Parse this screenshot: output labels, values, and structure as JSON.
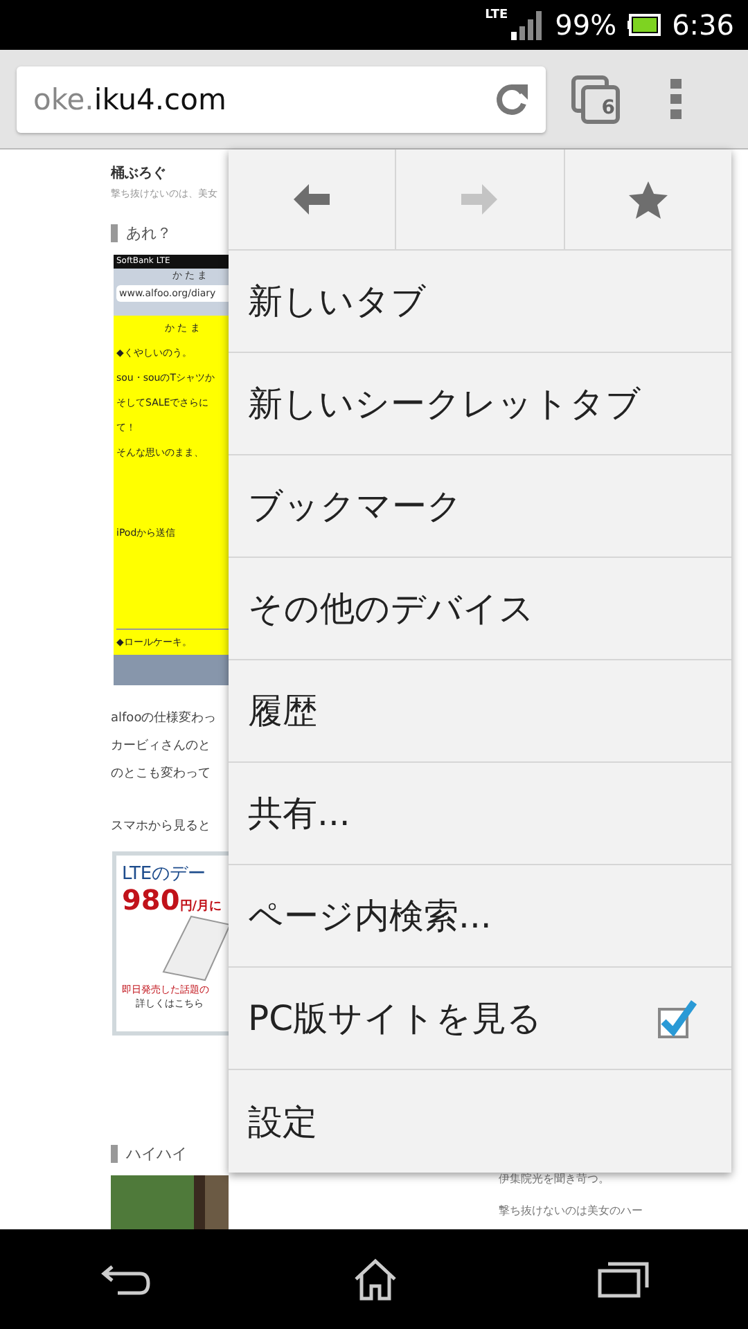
{
  "status_bar": {
    "network": "LTE",
    "battery": "99%",
    "time": "6:36"
  },
  "toolbar": {
    "url_host_prefix": "oke.",
    "url_domain": "iku4.com",
    "tab_count": "6"
  },
  "page": {
    "blog_title": "桶ぶろぐ",
    "blog_subtitle": "撃ち抜けないのは、美女",
    "post_title": "あれ？",
    "shot": {
      "carrier": "SoftBank  LTE",
      "header": "か た ま",
      "url": "www.alfoo.org/diary",
      "lines": [
        {
          "kind": "center",
          "text": "か た ま"
        },
        {
          "kind": "text",
          "text": "◆くやしいのう。"
        },
        {
          "kind": "text",
          "text": "sou・souのTシャツか"
        },
        {
          "kind": "text",
          "text": "そしてSALEでさらに"
        },
        {
          "kind": "text",
          "text": "て！"
        },
        {
          "kind": "text",
          "text": "そんな思いのまま、"
        },
        {
          "kind": "gap",
          "text": "iPodから送信"
        },
        {
          "kind": "rule",
          "text": "◆ロールケーキ。"
        }
      ]
    },
    "paragraphs": [
      {
        "lines": [
          "alfooの仕様変わっ",
          "カービィさんのと",
          "のとこも変わって"
        ]
      },
      {
        "lines": [
          "スマホから見ると"
        ]
      }
    ],
    "ad": {
      "headline": "LTEのデー",
      "price": "980",
      "unit": "円/月に",
      "note": "即日発売した話題の",
      "link": "詳しくはこちら"
    },
    "post_title_2": "ハイハイ",
    "side_lines": [
      "伊集院光を聞き苛つ。",
      "撃ち抜けないのは美女のハー"
    ]
  },
  "menu": {
    "nav": [
      {
        "kind": "back",
        "disabled": false
      },
      {
        "kind": "forward",
        "disabled": true
      },
      {
        "kind": "bookmark",
        "disabled": false
      }
    ],
    "items": [
      {
        "label": "新しいタブ"
      },
      {
        "label": "新しいシークレットタブ"
      },
      {
        "label": "ブックマーク"
      },
      {
        "label": "その他のデバイス"
      },
      {
        "label": "履歴"
      },
      {
        "label": "共有..."
      },
      {
        "label": "ページ内検索..."
      },
      {
        "label": "PC版サイトを見る",
        "checked": true
      },
      {
        "label": "設定"
      }
    ]
  }
}
